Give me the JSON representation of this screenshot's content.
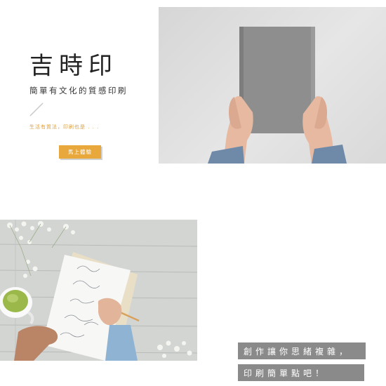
{
  "hero": {
    "title": "吉時印",
    "subtitle": "簡單有文化的質感印刷",
    "tagline": "生活有質法，印刷也是 . . .",
    "cta_label": "馬上體驗"
  },
  "captions": {
    "line1": "創作讓你思緒複雜，",
    "line2": "印刷簡單點吧！"
  },
  "colors": {
    "accent": "#e8a83b",
    "caption_bg": "#8a8a8a"
  }
}
